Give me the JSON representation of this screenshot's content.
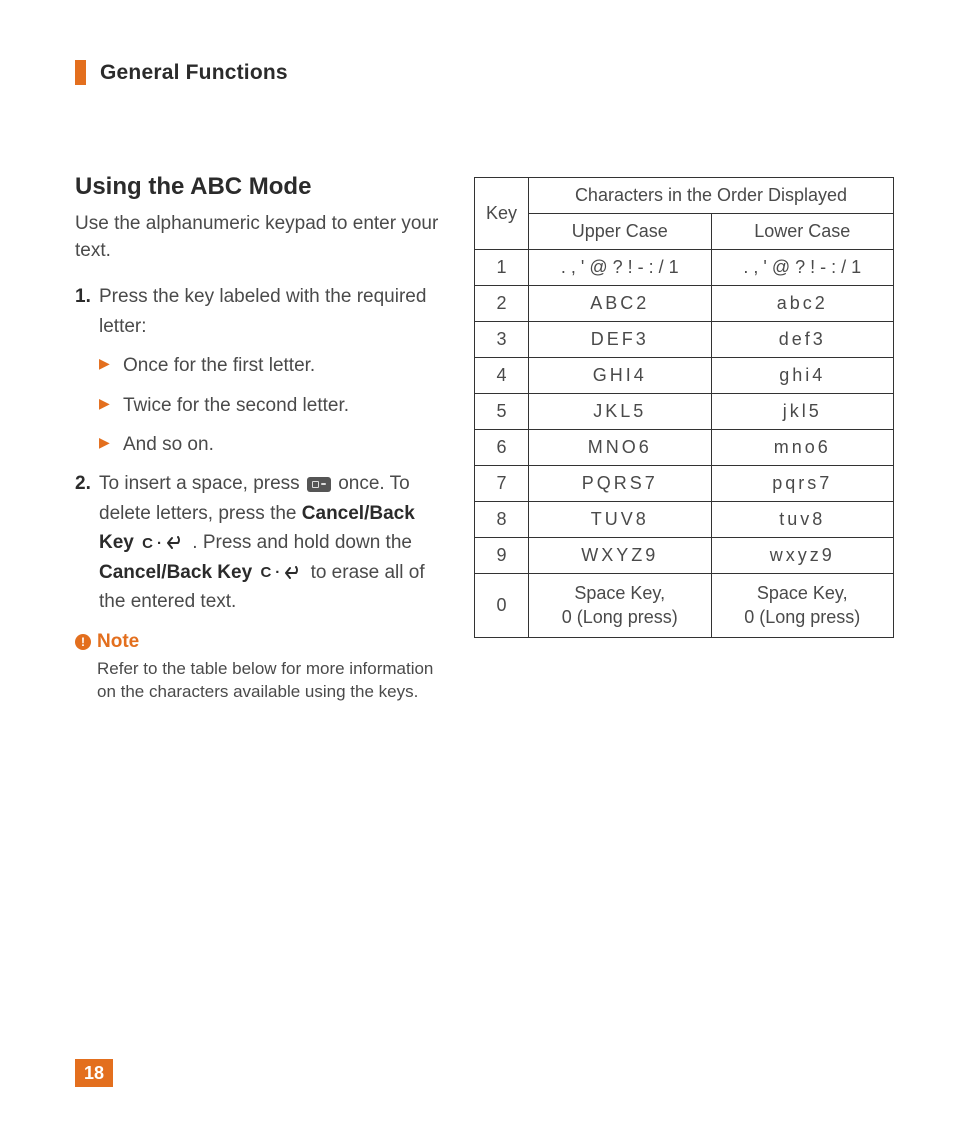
{
  "section_title": "General Functions",
  "heading": "Using the ABC Mode",
  "lead": "Use the alphanumeric keypad to enter your text.",
  "step1": "Press the key labeled with the required letter:",
  "step1_bullets": [
    "Once for the first letter.",
    "Twice for the second letter.",
    "And so on."
  ],
  "step2": {
    "a": "To insert a space, press ",
    "b": " once. To delete letters, press the ",
    "cancel_back_1": "Cancel/Back Key",
    "c": " . Press and hold down the ",
    "cancel_back_2": "Cancel/Back Key",
    "d": " to erase all of the entered text."
  },
  "cancel_letter": "C",
  "note": {
    "label": "Note",
    "body": "Refer to the table below for more information on the characters available using the keys."
  },
  "table": {
    "key_header": "Key",
    "span_header": "Characters in the Order Displayed",
    "upper_header": "Upper Case",
    "lower_header": "Lower Case",
    "rows": [
      {
        "key": "1",
        "upper": ". , ' @ ? ! - : / 1",
        "lower": ". , ' @ ? ! - : / 1",
        "spaced": false
      },
      {
        "key": "2",
        "upper": "ABC2",
        "lower": "abc2",
        "spaced": true
      },
      {
        "key": "3",
        "upper": "DEF3",
        "lower": "def3",
        "spaced": true
      },
      {
        "key": "4",
        "upper": "GHI4",
        "lower": "ghi4",
        "spaced": true
      },
      {
        "key": "5",
        "upper": "JKL5",
        "lower": "jkl5",
        "spaced": true
      },
      {
        "key": "6",
        "upper": "MNO6",
        "lower": "mno6",
        "spaced": true
      },
      {
        "key": "7",
        "upper": "PQRS7",
        "lower": "pqrs7",
        "spaced": true
      },
      {
        "key": "8",
        "upper": "TUV8",
        "lower": "tuv8",
        "spaced": true
      },
      {
        "key": "9",
        "upper": "WXYZ9",
        "lower": "wxyz9",
        "spaced": true
      },
      {
        "key": "0",
        "upper": "Space Key,\n0 (Long press)",
        "lower": "Space Key,\n0 (Long press)",
        "spaced": false
      }
    ]
  },
  "page_number": "18"
}
